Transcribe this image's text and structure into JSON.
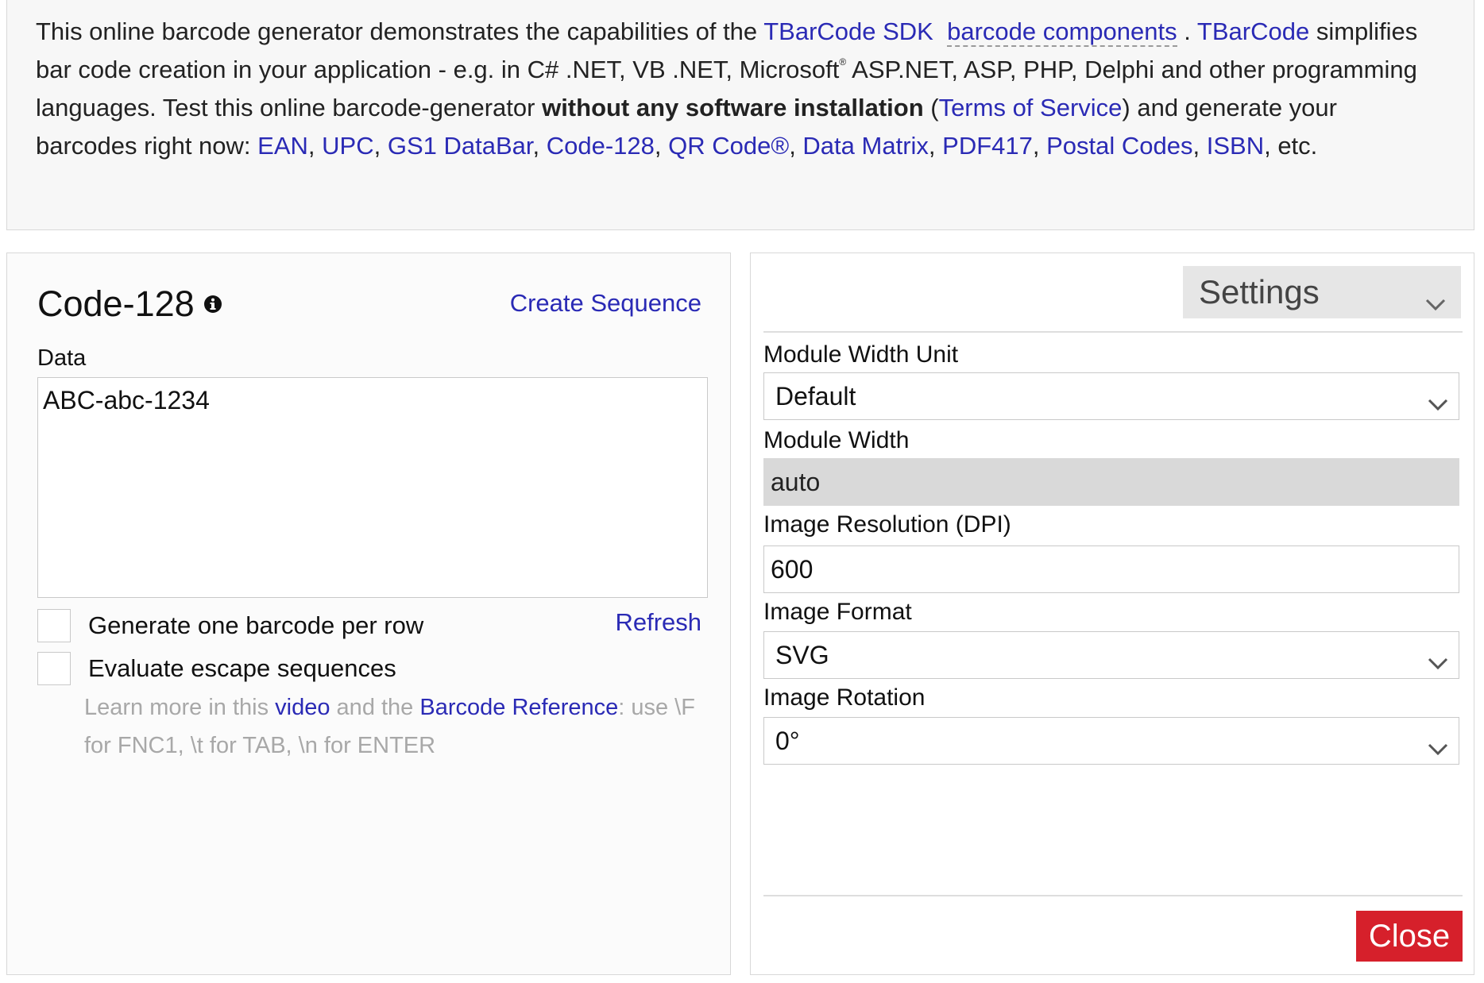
{
  "intro": {
    "t1": "This online barcode generator demonstrates the capabilities of the ",
    "link_sdk": "TBarCode SDK",
    "link_components": "barcode components",
    "t2": " . ",
    "link_tbarcode": "TBarCode",
    "t3": " simplifies bar code creation in your application - e.g. in C# .NET, VB .NET, Microsoft",
    "reg": "®",
    "t4": " ASP.NET, ASP, PHP, Delphi and other programming languages. Test this online barcode-generator ",
    "bold": "without any software installation",
    "t5": " (",
    "link_terms": "Terms of Service",
    "t6": ") and generate your barcodes right now: ",
    "links": [
      "EAN",
      "UPC",
      "GS1 DataBar",
      "Code-128",
      "QR Code®",
      "Data Matrix",
      "PDF417",
      "Postal Codes",
      "ISBN"
    ],
    "sep": ", ",
    "t7": ", etc."
  },
  "left": {
    "title": "Code-128",
    "create_sequence": "Create Sequence",
    "data_label": "Data",
    "data_value": "ABC-abc-1234",
    "checkbox_one_per_row": "Generate one barcode per row",
    "checkbox_escape": "Evaluate escape sequences",
    "refresh": "Refresh",
    "hint": {
      "p1": "Learn more in this ",
      "link_video": "video",
      "p2": " and the ",
      "link_reference": "Barcode Reference",
      "p3": ": use \\F for FNC1, \\t for TAB, \\n for ENTER"
    }
  },
  "right": {
    "settings_title": "Settings",
    "module_width_unit": {
      "label": "Module Width Unit",
      "value": "Default"
    },
    "module_width": {
      "label": "Module Width",
      "value": "auto"
    },
    "image_resolution": {
      "label": "Image Resolution (DPI)",
      "value": "600"
    },
    "image_format": {
      "label": "Image Format",
      "value": "SVG"
    },
    "image_rotation": {
      "label": "Image Rotation",
      "value": "0°"
    },
    "close_label": "Close"
  },
  "colors": {
    "link": "#2a2ab5",
    "close_button": "#d6202b",
    "panel_border": "#d8d8d8"
  },
  "icons": [
    "info-icon",
    "chevron-down-icon"
  ]
}
